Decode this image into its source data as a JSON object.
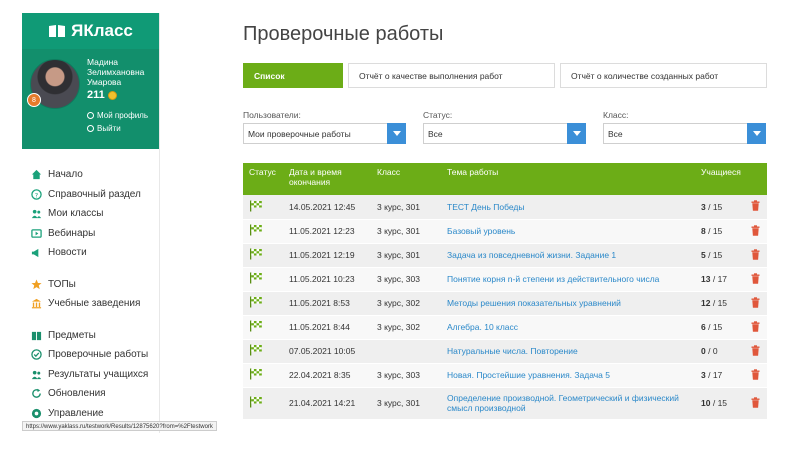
{
  "app": {
    "logo_text": "ЯКласс",
    "brand_color": "#109a76",
    "accent_color": "#6cad17"
  },
  "profile": {
    "name": "Мадина Зелимхановна Умарова",
    "points": "211",
    "my_profile": "Мой профиль",
    "logout": "Выйти",
    "badge": "8"
  },
  "nav": {
    "group1": [
      {
        "label": "Начало",
        "icon": "home-icon"
      },
      {
        "label": "Справочный раздел",
        "icon": "help-icon"
      },
      {
        "label": "Мои классы",
        "icon": "classes-icon"
      },
      {
        "label": "Вебинары",
        "icon": "video-icon"
      },
      {
        "label": "Новости",
        "icon": "news-icon"
      }
    ],
    "group2": [
      {
        "label": "ТОПы",
        "icon": "star-icon"
      },
      {
        "label": "Учебные заведения",
        "icon": "school-icon"
      }
    ],
    "group3": [
      {
        "label": "Предметы",
        "icon": "book-icon"
      },
      {
        "label": "Проверочные работы",
        "icon": "check-icon"
      },
      {
        "label": "Результаты учащихся",
        "icon": "results-icon"
      },
      {
        "label": "Обновления",
        "icon": "refresh-icon"
      },
      {
        "label": "Управление",
        "icon": "manage-icon"
      }
    ]
  },
  "main": {
    "title": "Проверочные работы",
    "tabs": [
      {
        "label": "Список"
      },
      {
        "label": "Отчёт о качестве выполнения работ"
      },
      {
        "label": "Отчёт о количестве созданных работ"
      }
    ],
    "filters": [
      {
        "label": "Пользователи:",
        "value": "Мои проверочные работы"
      },
      {
        "label": "Статус:",
        "value": "Все"
      },
      {
        "label": "Класс:",
        "value": "Все"
      }
    ],
    "columns": [
      "Статус",
      "Дата и время окончания",
      "Класс",
      "Тема работы",
      "Учащиеся"
    ],
    "rows": [
      {
        "date": "14.05.2021 12:45",
        "class": "3 курс, 301",
        "topic": "ТЕСТ День Победы",
        "done": "3",
        "total": "15"
      },
      {
        "date": "11.05.2021 12:23",
        "class": "3 курс, 301",
        "topic": "Базовый уровень",
        "done": "8",
        "total": "15"
      },
      {
        "date": "11.05.2021 12:19",
        "class": "3 курс, 301",
        "topic": "Задача из повседневной жизни. Задание 1",
        "done": "5",
        "total": "15"
      },
      {
        "date": "11.05.2021 10:23",
        "class": "3 курс, 303",
        "topic": "Понятие корня n-й степени из действительного числа",
        "done": "13",
        "total": "17"
      },
      {
        "date": "11.05.2021 8:53",
        "class": "3 курс, 302",
        "topic": "Методы решения показательных уравнений",
        "done": "12",
        "total": "15"
      },
      {
        "date": "11.05.2021 8:44",
        "class": "3 курс, 302",
        "topic": "Алгебра. 10 класс",
        "done": "6",
        "total": "15"
      },
      {
        "date": "07.05.2021 10:05",
        "class": "",
        "topic": "Натуральные числа. Повторение",
        "done": "0",
        "total": "0"
      },
      {
        "date": "22.04.2021 8:35",
        "class": "3 курс, 303",
        "topic": "Новая. Простейшие уравнения. Задача 5",
        "done": "3",
        "total": "17"
      },
      {
        "date": "21.04.2021 14:21",
        "class": "3 курс, 301",
        "topic": "Определение производной. Геометрический и физический смысл производной",
        "done": "10",
        "total": "15"
      }
    ]
  },
  "statusbar": {
    "url": "https://www.yaklass.ru/testwork/Results/12875620?from=%2Ftestwork"
  }
}
